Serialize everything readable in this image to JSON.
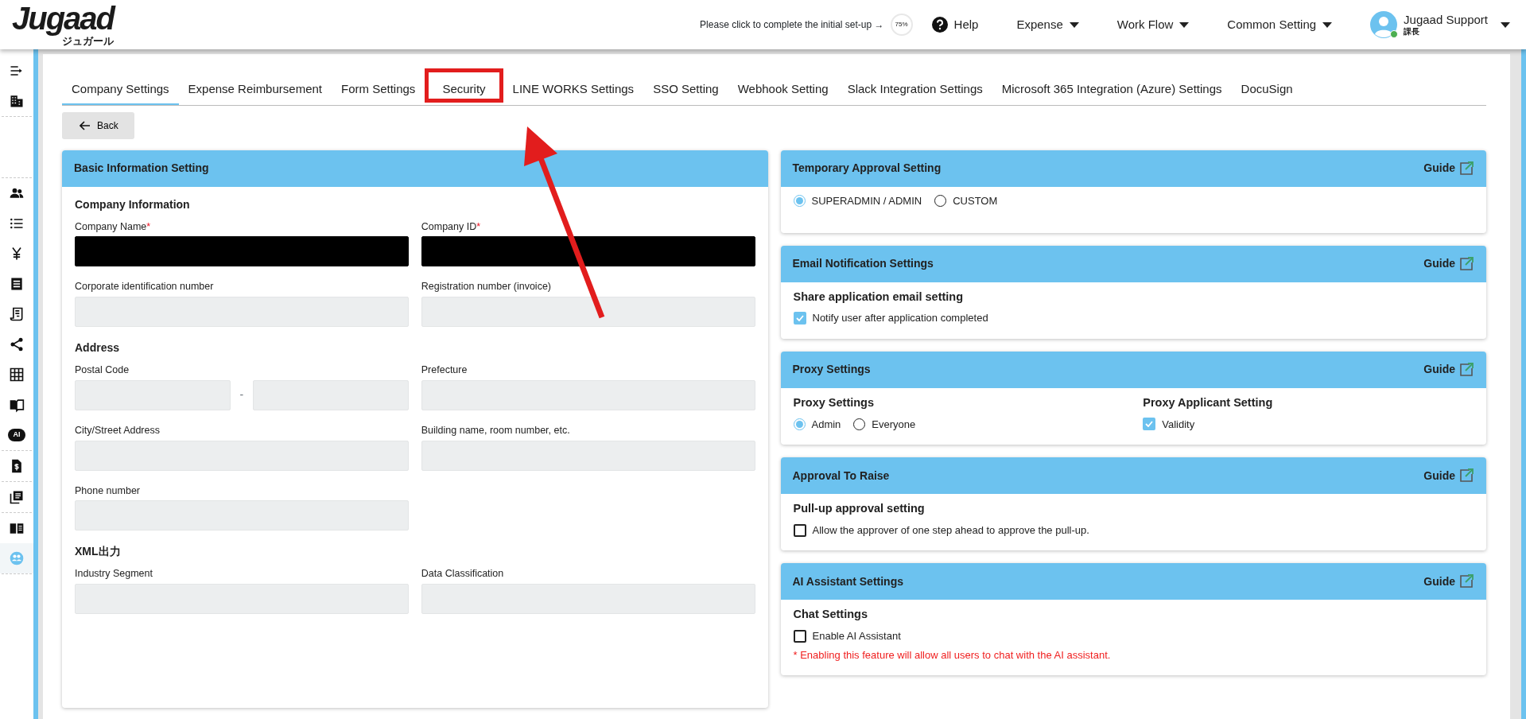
{
  "header": {
    "logo": "Jugaad",
    "logo_sub": "ジュガール",
    "setup_prompt": "Please click to complete the initial set-up →",
    "setup_progress": "75%",
    "help": "Help",
    "menus": [
      "Expense",
      "Work Flow",
      "Common Setting"
    ],
    "user": {
      "name": "Jugaad Support",
      "role": "課長",
      "online": true
    }
  },
  "sidebar": {
    "items": [
      {
        "selected": false
      },
      {
        "selected": false
      },
      {
        "selected": false
      },
      {
        "selected": false
      },
      {
        "selected": false
      },
      {
        "selected": false
      },
      {
        "selected": false
      },
      {
        "selected": false
      },
      {
        "selected": false
      },
      {
        "selected": false
      },
      {
        "selected": false,
        "text": "AI"
      },
      {
        "selected": false
      },
      {
        "selected": false
      },
      {
        "selected": false
      },
      {
        "selected": true
      }
    ]
  },
  "tabs": [
    {
      "label": "Company Settings",
      "selected": true,
      "highlighted": false
    },
    {
      "label": "Expense Reimbursement",
      "selected": false,
      "highlighted": false
    },
    {
      "label": "Form Settings",
      "selected": false,
      "highlighted": false
    },
    {
      "label": "Security",
      "selected": false,
      "highlighted": true
    },
    {
      "label": "LINE WORKS Settings",
      "selected": false,
      "highlighted": false
    },
    {
      "label": "SSO Setting",
      "selected": false,
      "highlighted": false
    },
    {
      "label": "Webhook Setting",
      "selected": false,
      "highlighted": false
    },
    {
      "label": "Slack Integration Settings",
      "selected": false,
      "highlighted": false
    },
    {
      "label": "Microsoft 365 Integration (Azure) Settings",
      "selected": false,
      "highlighted": false
    },
    {
      "label": "DocuSign",
      "selected": false,
      "highlighted": false
    }
  ],
  "annotation_arrow": true,
  "back_button": "Back",
  "basic_info": {
    "title": "Basic Information Setting",
    "sections": [
      {
        "heading": "Company Information",
        "rows": [
          [
            {
              "label": "Company Name",
              "required_mark": "*",
              "redacted": true
            },
            {
              "label": "Company ID",
              "required_mark": "*",
              "redacted": true
            }
          ],
          [
            {
              "label": "Corporate identification number",
              "redacted": false
            },
            {
              "label": "Registration number (invoice)",
              "redacted": false
            }
          ]
        ]
      },
      {
        "heading": "Address",
        "rows": [
          [
            {
              "label": "Postal Code",
              "kind": "split",
              "separator": "-",
              "redacted": false
            },
            {
              "label": "Prefecture",
              "redacted": false
            }
          ],
          [
            {
              "label": "City/Street Address",
              "redacted": false
            },
            {
              "label": "Building name, room number, etc.",
              "redacted": false
            }
          ],
          [
            {
              "label": "Phone number",
              "redacted": false
            }
          ]
        ]
      },
      {
        "heading": "XML出力",
        "rows": [
          [
            {
              "label": "Industry Segment",
              "redacted": false
            },
            {
              "label": "Data Classification",
              "redacted": false
            }
          ]
        ]
      }
    ]
  },
  "panels": [
    {
      "title": "Temporary Approval Setting",
      "guide": "Guide",
      "blocks": [
        {
          "kind": "radio",
          "options": [
            {
              "label": "SUPERADMIN / ADMIN",
              "selected": true
            },
            {
              "label": "CUSTOM",
              "selected": false
            }
          ]
        }
      ]
    },
    {
      "title": "Email Notification Settings",
      "guide": "Guide",
      "blocks": [
        {
          "kind": "heading",
          "text": "Share application email setting"
        },
        {
          "kind": "checkbox",
          "label": "Notify user after application completed",
          "checked": true
        }
      ]
    },
    {
      "title": "Proxy Settings",
      "guide": "Guide",
      "blocks": [
        {
          "kind": "columns",
          "columns": [
            [
              {
                "kind": "heading",
                "text": "Proxy Settings"
              },
              {
                "kind": "radio",
                "options": [
                  {
                    "label": "Admin",
                    "selected": true
                  },
                  {
                    "label": "Everyone",
                    "selected": false
                  }
                ]
              }
            ],
            [
              {
                "kind": "heading",
                "text": "Proxy Applicant Setting"
              },
              {
                "kind": "checkbox",
                "label": "Validity",
                "checked": true
              }
            ]
          ]
        }
      ]
    },
    {
      "title": "Approval To Raise",
      "guide": "Guide",
      "blocks": [
        {
          "kind": "heading",
          "text": "Pull-up approval setting"
        },
        {
          "kind": "checkbox",
          "label": "Allow the approver of one step ahead to approve the pull-up.",
          "checked": false
        }
      ]
    },
    {
      "title": "AI Assistant Settings",
      "guide": "Guide",
      "blocks": [
        {
          "kind": "heading",
          "text": "Chat Settings"
        },
        {
          "kind": "checkbox",
          "label": "Enable AI Assistant",
          "checked": false
        },
        {
          "kind": "note",
          "text": "* Enabling this feature will allow all users to chat with the AI assistant."
        }
      ]
    }
  ]
}
